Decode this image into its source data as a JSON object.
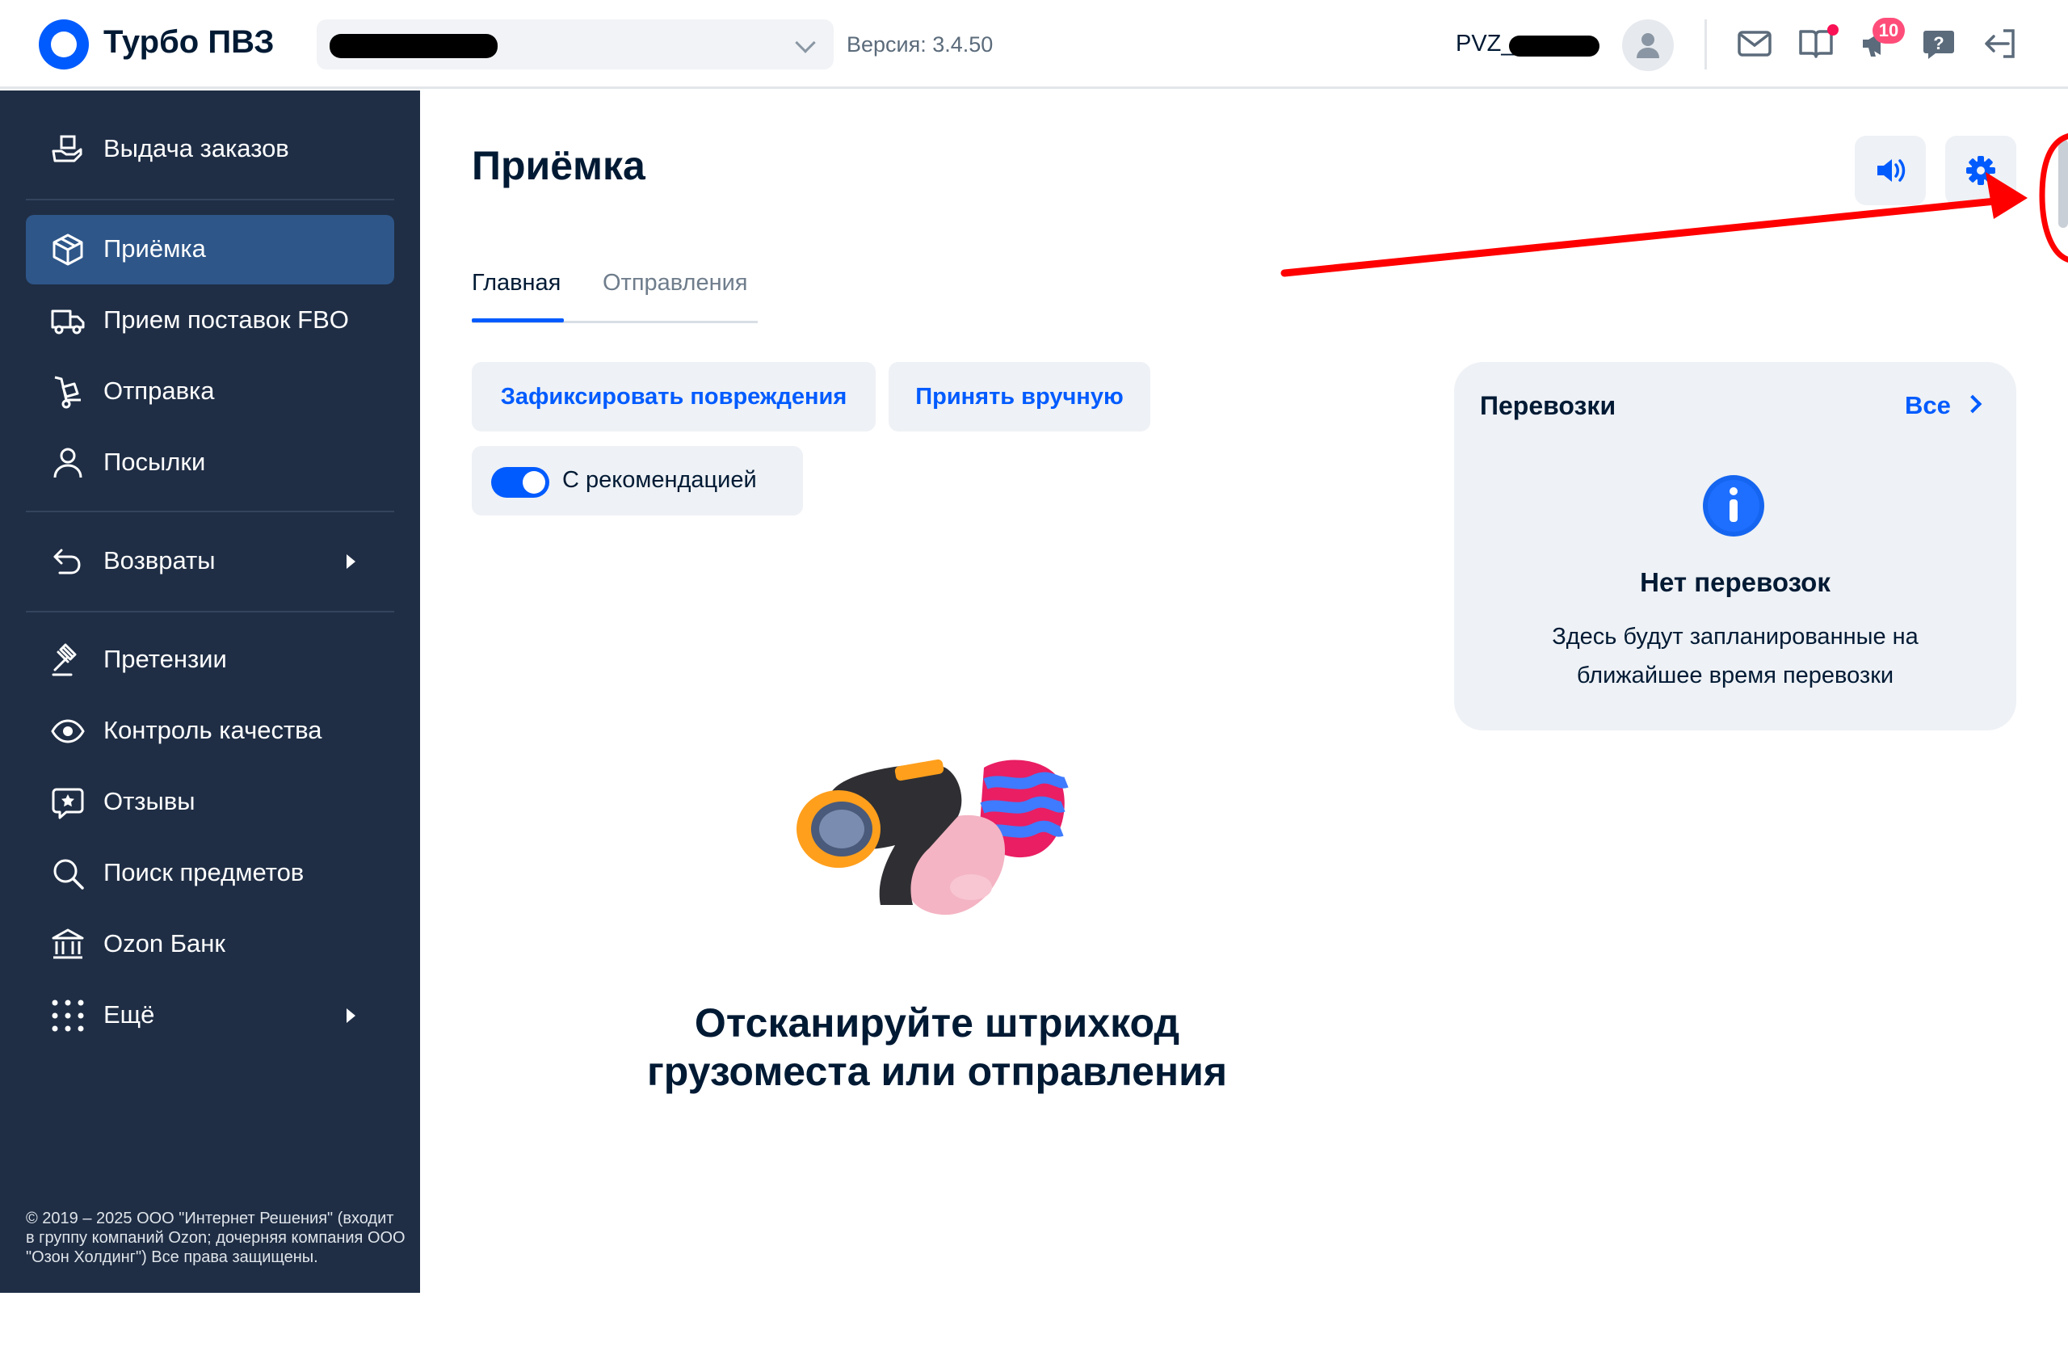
{
  "header": {
    "app_title": "Турбо ПВЗ",
    "version": "Версия: 3.4.50",
    "pvz_prefix": "PVZ_",
    "notifications_count": "10"
  },
  "sidebar": {
    "items": [
      {
        "label": "Выдача заказов",
        "icon": "hand-box-icon"
      },
      {
        "label": "Приёмка",
        "icon": "package-icon",
        "active": true
      },
      {
        "label": "Прием поставок FBO",
        "icon": "truck-icon"
      },
      {
        "label": "Отправка",
        "icon": "trolley-icon"
      },
      {
        "label": "Посылки",
        "icon": "person-icon"
      },
      {
        "label": "Возвраты",
        "icon": "return-icon",
        "has_submenu": true
      },
      {
        "label": "Претензии",
        "icon": "gavel-icon"
      },
      {
        "label": "Контроль качества",
        "icon": "eye-icon"
      },
      {
        "label": "Отзывы",
        "icon": "review-star-icon"
      },
      {
        "label": "Поиск предметов",
        "icon": "search-icon"
      },
      {
        "label": "Ozon Банк",
        "icon": "bank-icon"
      },
      {
        "label": "Ещё",
        "icon": "grid-dots-icon",
        "has_submenu": true
      }
    ],
    "copyright": "© 2019 – 2025 ООО \"Интернет Решения\" (входит в группу компаний Ozon; дочерняя компания ООО \"Озон Холдинг\") Все права защищены."
  },
  "main": {
    "title": "Приёмка",
    "tabs": [
      {
        "label": "Главная",
        "active": true
      },
      {
        "label": "Отправления",
        "active": false
      }
    ],
    "buttons": {
      "record_damage": "Зафиксировать повреждения",
      "accept_manually": "Принять вручную"
    },
    "toggle": {
      "label": "С рекомендацией",
      "on": true
    },
    "scan_prompt": "Отсканируйте штрихкод грузоместа или отправления"
  },
  "transport_card": {
    "title": "Перевозки",
    "all_link": "Все",
    "empty_title": "Нет перевозок",
    "empty_text": "Здесь будут запланированные на ближайшее время перевозки"
  },
  "colors": {
    "accent": "#005bff",
    "sidebar_bg": "#1f2e45",
    "sidebar_active": "#2e5689",
    "badge": "#ff4d7a",
    "annotation": "#ff0000"
  }
}
